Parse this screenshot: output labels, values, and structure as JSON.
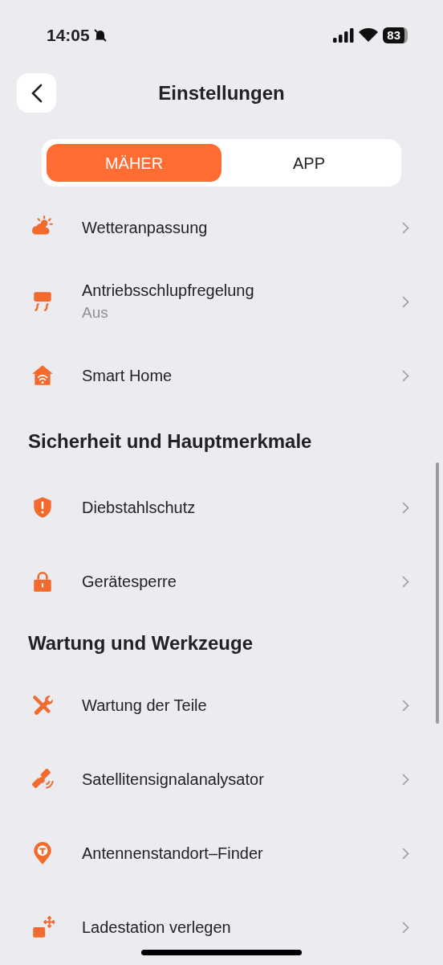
{
  "status_bar": {
    "time": "14:05",
    "battery": "83"
  },
  "header": {
    "title": "Einstellungen"
  },
  "tabs": [
    {
      "label": "MÄHER",
      "selected": true
    },
    {
      "label": "APP",
      "selected": false
    }
  ],
  "sections": [
    {
      "items": [
        {
          "label": "Wetteranpassung"
        },
        {
          "label": "Antriebsschlupfregelung",
          "value": "Aus"
        },
        {
          "label": "Smart Home"
        }
      ]
    },
    {
      "heading": "Sicherheit und Hauptmerkmale",
      "items": [
        {
          "label": "Diebstahlschutz"
        },
        {
          "label": "Gerätesperre"
        }
      ]
    },
    {
      "heading": "Wartung und Werkzeuge",
      "items": [
        {
          "label": "Wartung der Teile"
        },
        {
          "label": "Satellitensignalanalysator"
        },
        {
          "label": "Antennenstandort–Finder"
        },
        {
          "label": "Ladestation verlegen"
        }
      ]
    }
  ]
}
